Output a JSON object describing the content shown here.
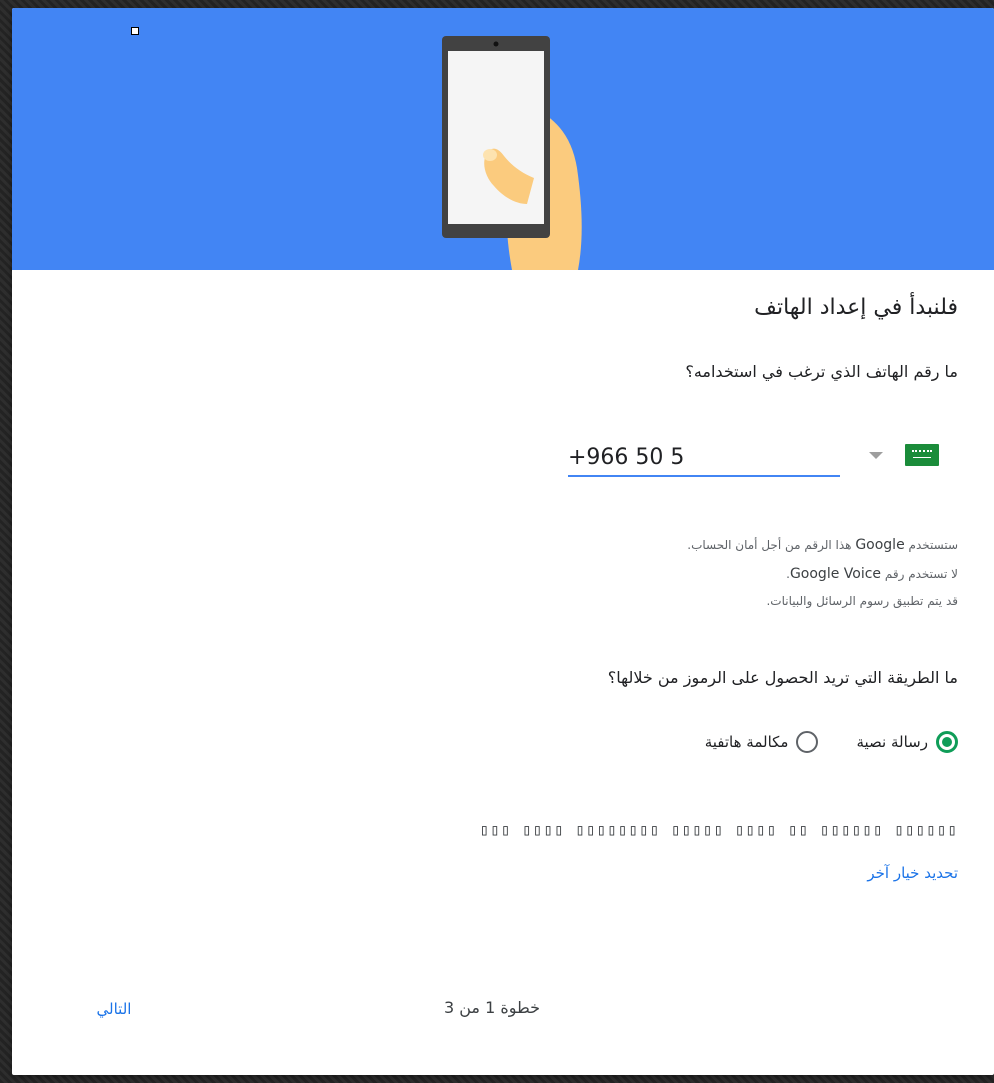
{
  "header": {
    "illustration": "hand-holding-phone-illustration",
    "colors": {
      "background": "#4285f4",
      "phone_body": "#424242",
      "screen": "#f5f5f5",
      "hand": "#fbcb7e"
    }
  },
  "title": "فلنبدأ في إعداد الهاتف",
  "phone_question": "ما رقم الهاتف الذي ترغب في استخدامه؟",
  "phone": {
    "country_flag": "saudi-arabia-flag",
    "value": "+966 50 5",
    "accent_color": "#4285f4"
  },
  "info": {
    "line1_prefix": "ستستخدم",
    "line1_brand": "Google",
    "line1_suffix": "هذا الرقم من أجل أمان الحساب.",
    "line2_prefix": "لا تستخدم رقم",
    "line2_brand": "Google Voice",
    "line2_suffix": ".",
    "line3": "قد يتم تطبيق رسوم الرسائل والبيانات."
  },
  "codes_question": "ما الطريقة التي تريد الحصول على الرموز من خلالها؟",
  "methods": {
    "sms_label": "رسالة نصية",
    "call_label": "مكالمة هاتفية",
    "selected": "sms",
    "selected_color": "#0f9d58"
  },
  "unrendered_text": "▯▯▯ ▯▯▯▯ ▯▯▯▯▯▯▯▯ ▯▯▯▯▯ ▯▯▯▯ ▯▯ ▯▯▯▯▯▯ ▯▯▯▯▯▯",
  "other_option_label": "تحديد خيار آخر",
  "footer": {
    "step_label": "خطوة 1 من 3",
    "next_label": "التالي",
    "link_color": "#1a73e8"
  }
}
